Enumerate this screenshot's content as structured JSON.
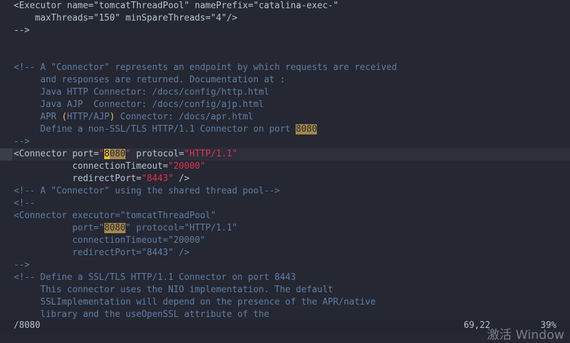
{
  "editor": {
    "lines": [
      [
        {
          "cls": "t",
          "text": "<Executor name=\"tomcatThreadPool\" namePrefix=\"catalina-exec-\""
        }
      ],
      [
        {
          "cls": "t",
          "text": "    maxThreads=\"150\" minSpareThreads=\"4\"/>"
        }
      ],
      [
        {
          "cls": "t",
          "text": "-->"
        }
      ],
      [
        {
          "cls": "t",
          "text": ""
        }
      ],
      [
        {
          "cls": "t",
          "text": ""
        }
      ],
      [
        {
          "cls": "c",
          "text": "<!-- A \"Connector\" represents an endpoint by which requests are received"
        }
      ],
      [
        {
          "cls": "c",
          "text": "     and responses are returned. Documentation at :"
        }
      ],
      [
        {
          "cls": "c",
          "text": "     Java HTTP Connector: /docs/config/http.html"
        }
      ],
      [
        {
          "cls": "c",
          "text": "     Java AJP  Connector: /docs/config/ajp.html"
        }
      ],
      [
        {
          "cls": "c",
          "text": "     APR "
        },
        {
          "cls": "delim",
          "text": "("
        },
        {
          "cls": "c",
          "text": "HTTP/AJP"
        },
        {
          "cls": "delim",
          "text": ")"
        },
        {
          "cls": "c",
          "text": " Connector: /docs/apr.html"
        }
      ],
      [
        {
          "cls": "c",
          "text": "     Define a non-SSL/TLS HTTP/1.1 Connector on port "
        },
        {
          "cls": "hl",
          "text": "8080"
        }
      ],
      [
        {
          "cls": "c",
          "text": "-->"
        }
      ],
      [
        {
          "cls": "t",
          "text": "<Connector port="
        },
        {
          "cls": "srt",
          "text": "\""
        },
        {
          "cls": "cur",
          "text": "8"
        },
        {
          "cls": "hl",
          "text": "080"
        },
        {
          "cls": "srt",
          "text": "\""
        },
        {
          "cls": "t",
          "text": " protocol="
        },
        {
          "cls": "srt",
          "text": "\"HTTP/1.1\""
        }
      ],
      [
        {
          "cls": "t",
          "text": "           connectionTimeout="
        },
        {
          "cls": "srt",
          "text": "\"20000\""
        }
      ],
      [
        {
          "cls": "t",
          "text": "           redirectPort="
        },
        {
          "cls": "srt",
          "text": "\"8443\""
        },
        {
          "cls": "t",
          "text": " />"
        }
      ],
      [
        {
          "cls": "c",
          "text": "<!-- A \"Connector\" using the shared thread pool-->"
        }
      ],
      [
        {
          "cls": "c",
          "text": "<!--"
        }
      ],
      [
        {
          "cls": "c",
          "text": "<Connector executor=\"tomcatThreadPool\""
        }
      ],
      [
        {
          "cls": "c",
          "text": "           port=\""
        },
        {
          "cls": "hl",
          "text": "8080"
        },
        {
          "cls": "c",
          "text": "\" protocol=\"HTTP/1.1\""
        }
      ],
      [
        {
          "cls": "c",
          "text": "           connectionTimeout=\"20000\""
        }
      ],
      [
        {
          "cls": "c",
          "text": "           redirectPort=\"8443\" />"
        }
      ],
      [
        {
          "cls": "c",
          "text": "-->"
        }
      ],
      [
        {
          "cls": "c",
          "text": "<!-- Define a SSL/TLS HTTP/1.1 Connector on port 8443"
        }
      ],
      [
        {
          "cls": "c",
          "text": "     This connector uses the NIO implementation. The default"
        }
      ],
      [
        {
          "cls": "c",
          "text": "     SSLImplementation will depend on the presence of the APR/native"
        }
      ],
      [
        {
          "cls": "c",
          "text": "     library and the useOpenSSL attribute of the"
        }
      ]
    ],
    "cursor_line_index": 12
  },
  "status": {
    "command": "/8080",
    "position": "69,22",
    "percent": "39%"
  },
  "watermark": "激活 Window"
}
